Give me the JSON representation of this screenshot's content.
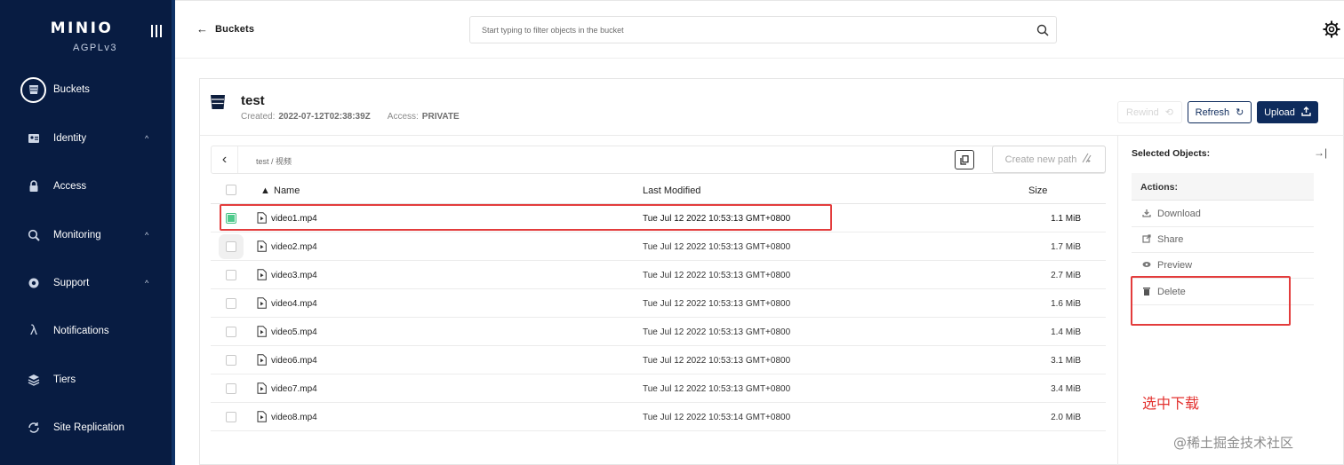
{
  "sidebar": {
    "brand": "MINIO",
    "license": "AGPLv3",
    "items": [
      {
        "label": "Buckets",
        "icon": "bucket-icon",
        "active": true
      },
      {
        "label": "Identity",
        "icon": "identity-icon",
        "expandable": true
      },
      {
        "label": "Access",
        "icon": "lock-icon"
      },
      {
        "label": "Monitoring",
        "icon": "monitoring-icon",
        "expandable": true
      },
      {
        "label": "Support",
        "icon": "support-icon",
        "expandable": true
      },
      {
        "label": "Notifications",
        "icon": "lambda-icon"
      },
      {
        "label": "Tiers",
        "icon": "tiers-icon"
      },
      {
        "label": "Site Replication",
        "icon": "replication-icon"
      }
    ]
  },
  "header": {
    "back_label": "Buckets",
    "search_placeholder": "Start typing to filter objects in the bucket"
  },
  "bucket": {
    "name": "test",
    "created_label": "Created:",
    "created_value": "2022-07-12T02:38:39Z",
    "access_label": "Access:",
    "access_value": "PRIVATE",
    "rewind_label": "Rewind",
    "refresh_label": "Refresh",
    "upload_label": "Upload"
  },
  "path": {
    "breadcrumb": "test / 视频",
    "create_new_path_label": "Create new path"
  },
  "table": {
    "columns": {
      "name": "Name",
      "last_modified": "Last Modified",
      "size": "Size"
    },
    "rows": [
      {
        "name": "video1.mp4",
        "modified": "Tue Jul 12 2022 10:53:13 GMT+0800",
        "size": "1.1 MiB",
        "selected": true
      },
      {
        "name": "video2.mp4",
        "modified": "Tue Jul 12 2022 10:53:13 GMT+0800",
        "size": "1.7 MiB",
        "selected": false
      },
      {
        "name": "video3.mp4",
        "modified": "Tue Jul 12 2022 10:53:13 GMT+0800",
        "size": "2.7 MiB",
        "selected": false
      },
      {
        "name": "video4.mp4",
        "modified": "Tue Jul 12 2022 10:53:13 GMT+0800",
        "size": "1.6 MiB",
        "selected": false
      },
      {
        "name": "video5.mp4",
        "modified": "Tue Jul 12 2022 10:53:13 GMT+0800",
        "size": "1.4 MiB",
        "selected": false
      },
      {
        "name": "video6.mp4",
        "modified": "Tue Jul 12 2022 10:53:13 GMT+0800",
        "size": "3.1 MiB",
        "selected": false
      },
      {
        "name": "video7.mp4",
        "modified": "Tue Jul 12 2022 10:53:13 GMT+0800",
        "size": "3.4 MiB",
        "selected": false
      },
      {
        "name": "video8.mp4",
        "modified": "Tue Jul 12 2022 10:53:14 GMT+0800",
        "size": "2.0 MiB",
        "selected": false
      }
    ]
  },
  "panel": {
    "selected_objects_label": "Selected Objects:",
    "actions_label": "Actions:",
    "actions": [
      {
        "label": "Download",
        "icon": "download-icon"
      },
      {
        "label": "Share",
        "icon": "share-icon"
      },
      {
        "label": "Preview",
        "icon": "eye-icon"
      },
      {
        "label": "Delete",
        "icon": "trash-icon"
      }
    ]
  },
  "annotation": {
    "note": "选中下载",
    "color": "#e3322f"
  },
  "watermark": "@稀土掘金技术社区",
  "colors": {
    "sidebar_bg": "#081c42",
    "primary": "#0e2b5c",
    "checkbox_checked": "#4ecb8c"
  }
}
